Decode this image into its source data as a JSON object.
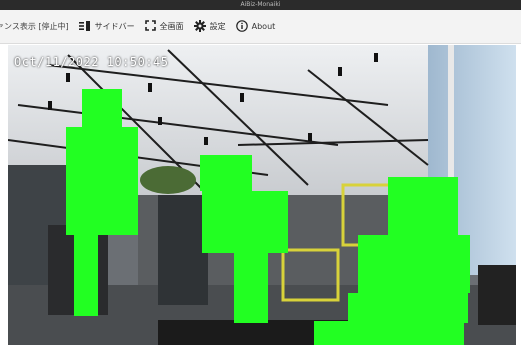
{
  "window": {
    "title": "AiBiz-Monaiki"
  },
  "toolbar": {
    "mode_label": "ァンス表示 [停止中]",
    "sidebar_label": "サイドバー",
    "fullscreen_label": "全画面",
    "settings_label": "設定",
    "about_label": "About",
    "icons": [
      "sidebar-icon",
      "fullscreen-icon",
      "gear-icon",
      "info-icon"
    ]
  },
  "video": {
    "timestamp": "Oct/11/2022 10:50:45",
    "overlay_color": "#22ff22"
  }
}
